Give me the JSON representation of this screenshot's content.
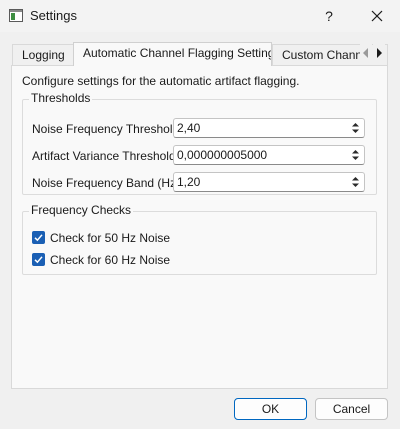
{
  "window": {
    "title": "Settings",
    "help_label": "?"
  },
  "tabs": [
    {
      "label": "Logging",
      "active": false
    },
    {
      "label": "Automatic Channel Flagging Settings",
      "active": true
    },
    {
      "label": "Custom Channel",
      "active": false
    }
  ],
  "panel": {
    "description": "Configure settings for the automatic artifact flagging.",
    "thresholds": {
      "title": "Thresholds",
      "fields": [
        {
          "label": "Noise Frequency Threshold:",
          "value": "2,40"
        },
        {
          "label": "Artifact Variance Threshold:",
          "value": "0,000000005000"
        },
        {
          "label": "Noise Frequency Band (Hz):",
          "value": "1,20"
        }
      ]
    },
    "frequency_checks": {
      "title": "Frequency Checks",
      "checks": [
        {
          "label": "Check for 50 Hz Noise",
          "checked": true
        },
        {
          "label": "Check for 60 Hz Noise",
          "checked": true
        }
      ]
    }
  },
  "buttons": {
    "ok_label": "OK",
    "cancel_label": "Cancel"
  },
  "colors": {
    "accent": "#1a5fb4",
    "default_button_border": "#0067c0"
  }
}
